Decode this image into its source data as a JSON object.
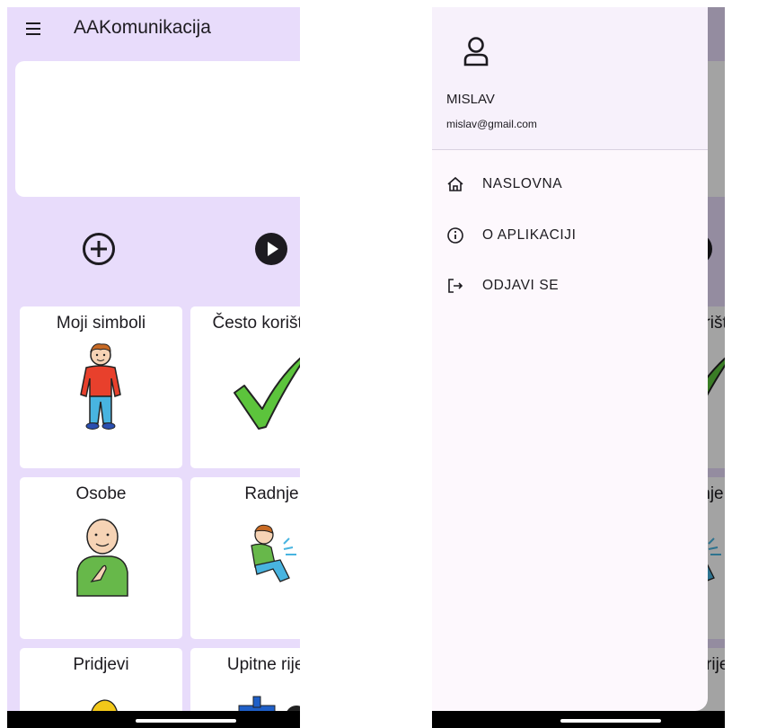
{
  "app": {
    "title": "AAKomunikacija"
  },
  "categories": [
    {
      "label": "Moji simboli",
      "icon": "boy-pictogram"
    },
    {
      "label": "Često korišteno",
      "icon": "check-mark-pictogram"
    },
    {
      "label": "Osobe",
      "icon": "person-pointing-pictogram"
    },
    {
      "label": "Radnje",
      "icon": "boy-sitting-pictogram"
    },
    {
      "label": "Pridjevi",
      "icon": "adjective-pictogram"
    },
    {
      "label": "Upitne riječi",
      "icon": "question-pictogram"
    }
  ],
  "controls": {
    "add_icon": "add-circle-icon",
    "play_icon": "play-circle-icon",
    "backspace_icon": "backspace-icon"
  },
  "drawer": {
    "user": {
      "name": "MISLAV",
      "email": "mislav@gmail.com"
    },
    "items": [
      {
        "label": "NASLOVNA",
        "icon": "home-icon"
      },
      {
        "label": "O APLIKACIJI",
        "icon": "info-icon"
      },
      {
        "label": "ODJAVI SE",
        "icon": "logout-icon"
      }
    ]
  },
  "colors": {
    "background": "#e8dcfb",
    "tile": "#ffffff",
    "drawer": "#fdf8fd",
    "check_green": "#5cc43c",
    "shirt_red": "#e8402c",
    "shirt_green": "#67b84a"
  }
}
